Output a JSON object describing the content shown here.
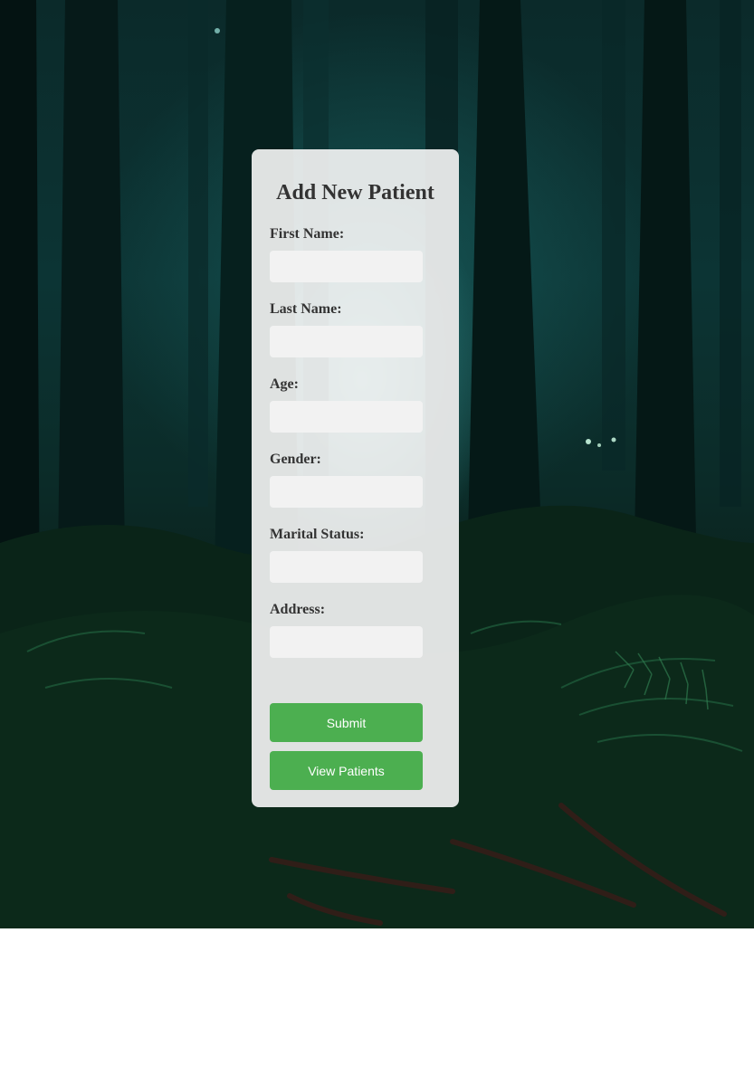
{
  "form": {
    "title": "Add New Patient",
    "fields": [
      {
        "label": "First Name:",
        "value": ""
      },
      {
        "label": "Last Name:",
        "value": ""
      },
      {
        "label": "Age:",
        "value": ""
      },
      {
        "label": "Gender:",
        "value": ""
      },
      {
        "label": "Marital Status:",
        "value": ""
      },
      {
        "label": "Address:",
        "value": ""
      }
    ],
    "submit_label": "Submit",
    "view_label": "View Patients"
  },
  "colors": {
    "button": "#4caf50",
    "button_text": "#ffffff",
    "card_background": "#f5f5f5",
    "input_background": "#f2f2f2",
    "text": "#333333"
  }
}
